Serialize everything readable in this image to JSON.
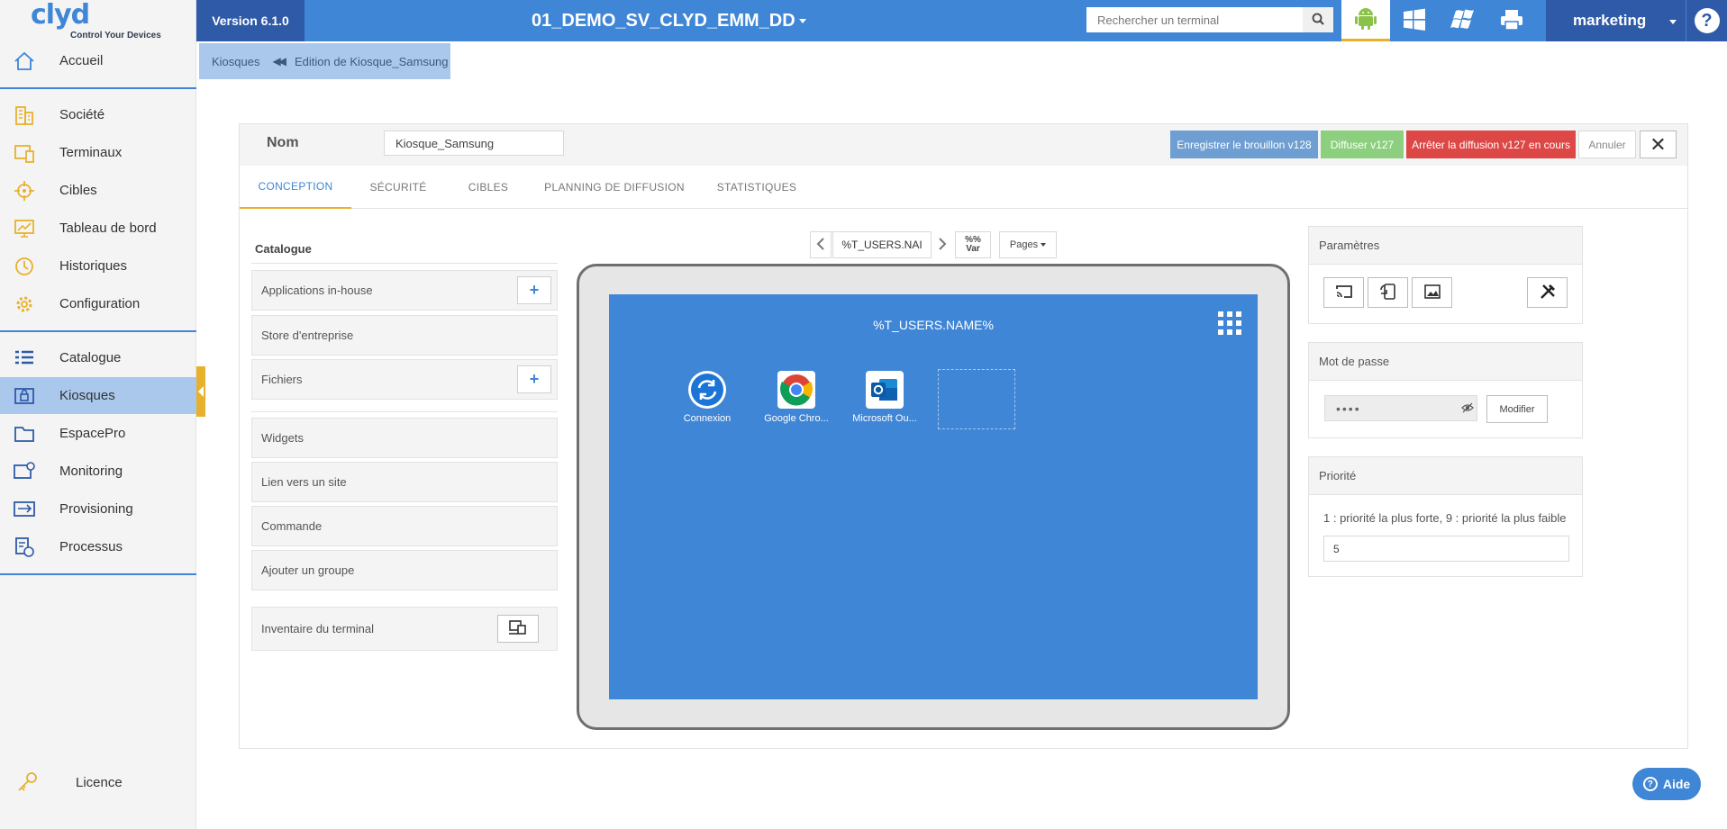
{
  "app": {
    "logo_text": "clyd",
    "logo_tagline": "Control Your Devices",
    "version": "Version 6.1.0",
    "project": "01_DEMO_SV_CLYD_EMM_DD",
    "user": "marketing",
    "help_glyph": "?"
  },
  "search": {
    "placeholder": "Rechercher un terminal",
    "icon": "search-icon"
  },
  "os_filters": [
    {
      "name": "android-icon",
      "active": true
    },
    {
      "name": "windows-icon",
      "active": false
    },
    {
      "name": "windows-xp-icon",
      "active": false
    },
    {
      "name": "printer-icon",
      "active": false
    }
  ],
  "sidebar": {
    "items": [
      {
        "label": "Accueil",
        "icon": "home-icon"
      },
      {
        "label": "Société",
        "icon": "building-icon"
      },
      {
        "label": "Terminaux",
        "icon": "devices-icon"
      },
      {
        "label": "Cibles",
        "icon": "target-icon"
      },
      {
        "label": "Tableau de bord",
        "icon": "dashboard-icon"
      },
      {
        "label": "Historiques",
        "icon": "history-icon"
      },
      {
        "label": "Configuration",
        "icon": "gear-icon"
      },
      {
        "label": "Catalogue",
        "icon": "catalog-icon"
      },
      {
        "label": "Kiosques",
        "icon": "kiosk-icon",
        "active": true
      },
      {
        "label": "EspacePro",
        "icon": "folder-icon"
      },
      {
        "label": "Monitoring",
        "icon": "monitoring-icon"
      },
      {
        "label": "Provisioning",
        "icon": "provisioning-icon"
      },
      {
        "label": "Processus",
        "icon": "process-icon"
      }
    ],
    "licence": {
      "label": "Licence",
      "icon": "key-icon"
    }
  },
  "breadcrumb": {
    "parent": "Kiosques",
    "current": "Edition de Kiosque_Samsung"
  },
  "editor": {
    "name_label": "Nom",
    "name_value": "Kiosque_Samsung",
    "buttons": {
      "save_draft": "Enregistrer le brouillon v128",
      "publish": "Diffuser v127",
      "stop": "Arrêter la diffusion v127 en cours",
      "cancel": "Annuler",
      "close": "✕"
    },
    "tabs": [
      "CONCEPTION",
      "SÉCURITÉ",
      "CIBLES",
      "PLANNING DE DIFFUSION",
      "STATISTIQUES"
    ],
    "active_tab": "CONCEPTION"
  },
  "catalogue": {
    "title": "Catalogue",
    "items": [
      "Applications in-house",
      "Store d'entreprise",
      "Fichiers",
      "Widgets",
      "Lien vers un site",
      "Commande",
      "Ajouter un groupe",
      "Inventaire du terminal"
    ],
    "plus": "+"
  },
  "designer": {
    "variable_field": "%T_USERS.NAI",
    "var_button_top": "%%",
    "var_button_bottom": "Var",
    "pages_button": "Pages",
    "screen_title": "%T_USERS.NAME%",
    "apps": [
      {
        "label": "Connexion",
        "icon": "sync-icon"
      },
      {
        "label": "Google Chro...",
        "icon": "chrome-icon"
      },
      {
        "label": "Microsoft Ou...",
        "icon": "outlook-icon"
      }
    ]
  },
  "right_panel": {
    "params_title": "Paramètres",
    "password_title": "Mot de passe",
    "password_value": "••••",
    "password_edit": "Modifier",
    "priority_title": "Priorité",
    "priority_desc": "1 : priorité la plus forte, 9 : priorité la plus faible",
    "priority_value": "5"
  },
  "help_button": "Aide",
  "colors": {
    "primary": "#3f86d6",
    "dark_primary": "#2f5aa7",
    "accent": "#e8b12c",
    "draft": "#6e9ed2",
    "publish": "#8ccf7f",
    "stop": "#dd4746"
  }
}
